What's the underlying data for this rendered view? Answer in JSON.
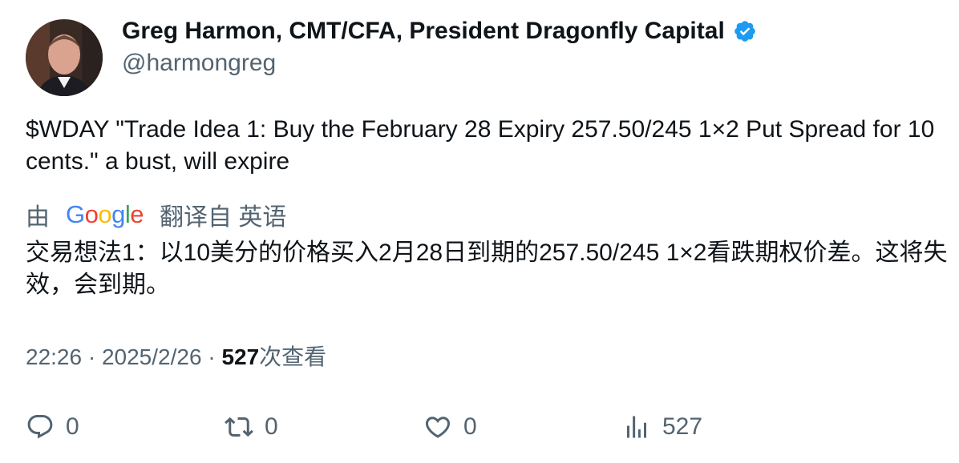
{
  "author": {
    "name": "Greg Harmon, CMT/CFA, President Dragonfly Capital",
    "handle": "@harmongreg",
    "verified": true
  },
  "tweet": {
    "text": "$WDAY \"Trade Idea 1: Buy the February 28 Expiry 257.50/245 1×2 Put Spread for 10 cents.\" a bust, will expire"
  },
  "translation": {
    "prefix": "由",
    "provider": "Google",
    "suffix": "翻译自 英语",
    "text": "交易想法1：以10美分的价格买入2月28日到期的257.50/245 1×2看跌期权价差。这将失效，会到期。"
  },
  "meta": {
    "time": "22:26",
    "date": "2025/2/26",
    "separator": "·",
    "views_count": "527",
    "views_label": "次查看"
  },
  "actions": {
    "replies": "0",
    "retweets": "0",
    "likes": "0",
    "views": "527"
  },
  "colors": {
    "verified_blue": "#1d9bf0",
    "secondary_text": "#536471"
  }
}
